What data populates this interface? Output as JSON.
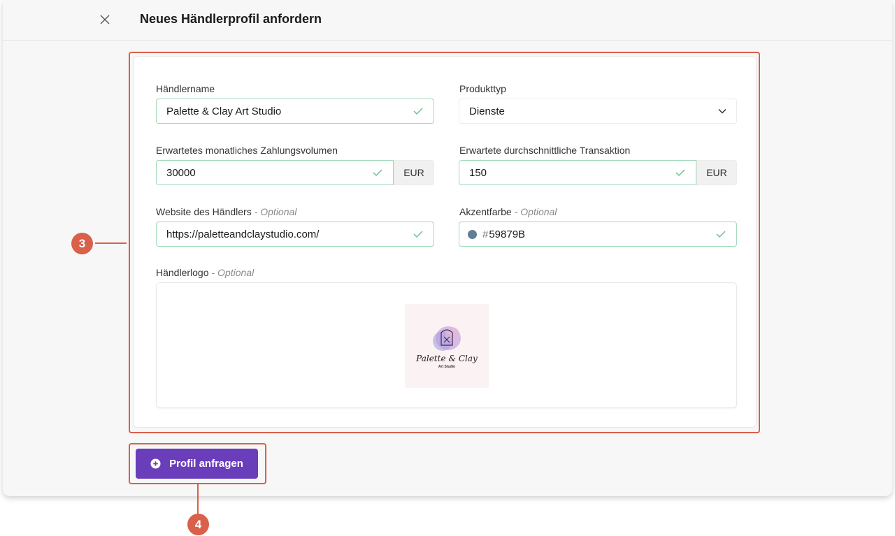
{
  "header": {
    "title": "Neues Händlerprofil anfordern",
    "close_icon": "close-icon"
  },
  "form": {
    "merchant_name": {
      "label": "Händlername",
      "value": "Palette & Clay Art Studio"
    },
    "product_type": {
      "label": "Produkttyp",
      "value": "Dienste"
    },
    "monthly_volume": {
      "label": "Erwartetes monatliches Zahlungsvolumen",
      "value": "30000",
      "currency": "EUR"
    },
    "avg_transaction": {
      "label": "Erwartete durchschnittliche Transaktion",
      "value": "150",
      "currency": "EUR"
    },
    "website": {
      "label": "Website des Händlers",
      "optional": "- Optional",
      "value": "https://paletteandclaystudio.com/"
    },
    "accent_color": {
      "label": "Akzentfarbe",
      "optional": "- Optional",
      "hash": "#",
      "value": "59879B",
      "swatch": "#5f7f94"
    },
    "logo": {
      "label": "Händlerlogo",
      "optional": "- Optional",
      "script_text": "Palette & Clay",
      "sub_text": "Art Studio"
    }
  },
  "submit": {
    "label": "Profil anfragen",
    "icon": "plus-circle-icon"
  },
  "annotations": {
    "form_badge": "3",
    "button_badge": "4",
    "color": "#d9604a"
  },
  "colors": {
    "accent": "#6a3dba",
    "valid_border": "#9fd8b8",
    "check": "#6cc28f"
  }
}
